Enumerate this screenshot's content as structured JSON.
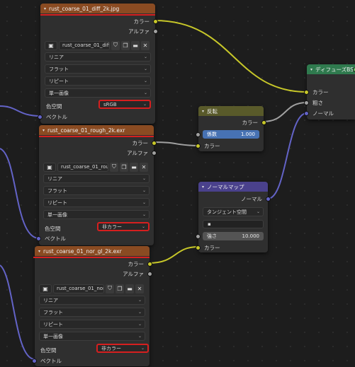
{
  "node_diff": {
    "title": "rust_coarse_01_diff_2k.jpg",
    "out_color": "カラー",
    "out_alpha": "アルファ",
    "image_name": "rust_coarse_01_diff...",
    "interpolation": "リニア",
    "projection": "フラット",
    "extension": "リピート",
    "source": "単一画像",
    "colorspace_label": "色空間",
    "colorspace_value": "sRGB",
    "in_vector": "ベクトル"
  },
  "node_rough": {
    "title": "rust_coarse_01_rough_2k.exr",
    "out_color": "カラー",
    "out_alpha": "アルファ",
    "image_name": "rust_coarse_01_rou...",
    "interpolation": "リニア",
    "projection": "フラット",
    "extension": "リピート",
    "source": "単一画像",
    "colorspace_label": "色空間",
    "colorspace_value": "非カラー",
    "in_vector": "ベクトル"
  },
  "node_nor": {
    "title": "rust_coarse_01_nor_gl_2k.exr",
    "out_color": "カラー",
    "out_alpha": "アルファ",
    "image_name": "rust_coarse_01_nor...",
    "interpolation": "リニア",
    "projection": "フラット",
    "extension": "リピート",
    "source": "単一画像",
    "colorspace_label": "色空間",
    "colorspace_value": "非カラー",
    "in_vector": "ベクトル"
  },
  "node_invert": {
    "title": "反転",
    "out_color": "カラー",
    "factor_label": "係数",
    "factor_value": "1.000",
    "in_color": "カラー"
  },
  "node_normalmap": {
    "title": "ノーマルマップ",
    "out_normal": "ノーマル",
    "space": "タンジェント空間",
    "uv_value": "",
    "strength_label": "強さ",
    "strength_value": "10.000",
    "in_color": "カラー"
  },
  "node_diffuse": {
    "title": "ディフューズBSDF",
    "in_color": "カラー",
    "in_roughness": "粗さ",
    "in_normal": "ノーマル"
  },
  "colors": {
    "texture_header": "#8a4b22",
    "converter_header": "#595a2a",
    "vector_header": "#4a418c",
    "shader_header": "#2f7a4e",
    "color_socket": "#c7c729",
    "float_socket": "#a1a1a1",
    "vector_socket": "#6363c7",
    "highlight_red": "#d61f1f"
  },
  "icons": [
    "image-icon",
    "shield-icon",
    "copy-icon",
    "folder-icon",
    "close-icon",
    "chevron-down-icon"
  ]
}
